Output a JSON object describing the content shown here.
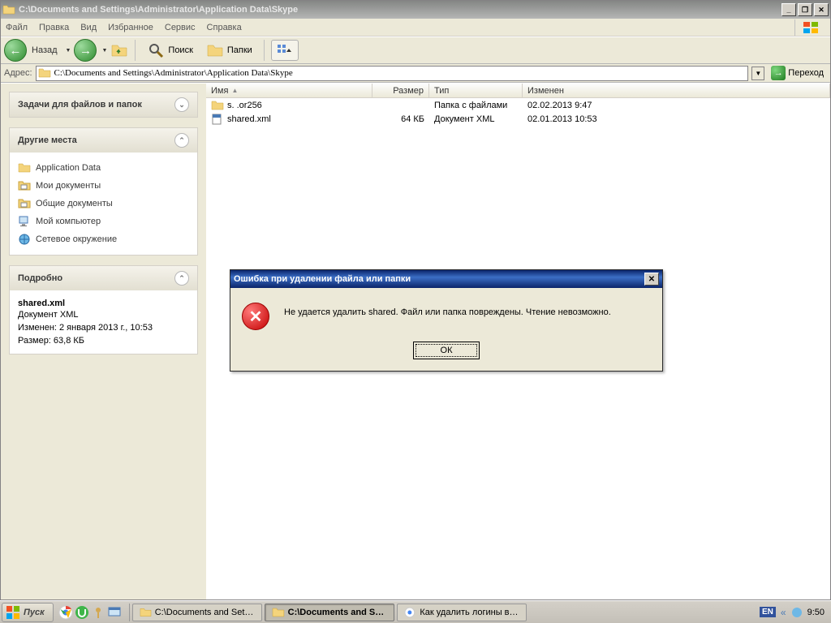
{
  "window": {
    "title": "C:\\Documents and Settings\\Administrator\\Application Data\\Skype"
  },
  "menu": {
    "items": [
      "Файл",
      "Правка",
      "Вид",
      "Избранное",
      "Сервис",
      "Справка"
    ]
  },
  "toolbar": {
    "back": "Назад",
    "search": "Поиск",
    "folders": "Папки"
  },
  "addressbar": {
    "label": "Адрес:",
    "path": "C:\\Documents and Settings\\Administrator\\Application Data\\Skype",
    "go": "Переход"
  },
  "sidepane": {
    "tasks_header": "Задачи для файлов и папок",
    "places_header": "Другие места",
    "places": [
      {
        "icon": "folder",
        "label": "Application Data"
      },
      {
        "icon": "mydocs",
        "label": "Мои документы"
      },
      {
        "icon": "shareddocs",
        "label": "Общие документы"
      },
      {
        "icon": "mycomputer",
        "label": "Мой компьютер"
      },
      {
        "icon": "network",
        "label": "Сетевое окружение"
      }
    ],
    "details_header": "Подробно",
    "details": {
      "name": "shared.xml",
      "type": "Документ XML",
      "modified_label": "Изменен: 2 января 2013 г., 10:53",
      "size_label": "Размер: 63,8 КБ"
    }
  },
  "columns": {
    "name": "Имя",
    "size": "Размер",
    "type": "Тип",
    "modified": "Изменен"
  },
  "files": [
    {
      "icon": "folder",
      "name": "s.   .or256",
      "size": "",
      "type": "Папка с файлами",
      "modified": "02.02.2013 9:47"
    },
    {
      "icon": "xml",
      "name": "shared.xml",
      "size": "64 КБ",
      "type": "Документ XML",
      "modified": "02.01.2013 10:53"
    }
  ],
  "dialog": {
    "title": "Ошибка при удалении файла или папки",
    "message": "Не удается удалить shared. Файл или папка повреждены. Чтение невозможно.",
    "ok": "ОК"
  },
  "taskbar": {
    "start": "Пуск",
    "tasks": [
      {
        "label": "C:\\Documents and Settin...",
        "active": false,
        "icon": "folder"
      },
      {
        "label": "C:\\Documents and Se...",
        "active": true,
        "icon": "folder"
      },
      {
        "label": "Как удалить логины вв...",
        "active": false,
        "icon": "chrome"
      }
    ],
    "lang": "EN",
    "clock": "9:50"
  }
}
